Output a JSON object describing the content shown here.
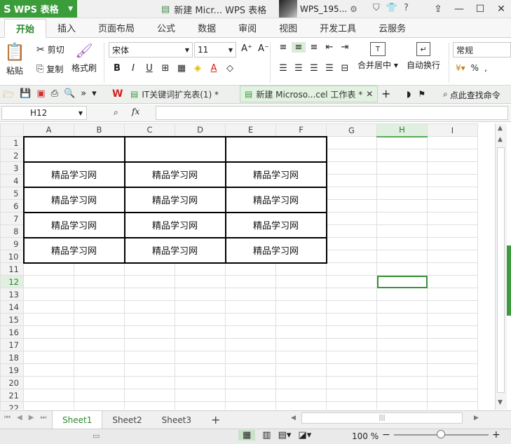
{
  "titlebar": {
    "app_name": "WPS 表格",
    "doc_title": "新建 Micr... WPS 表格",
    "user_name": "WPS_195..."
  },
  "menu": [
    "开始",
    "插入",
    "页面布局",
    "公式",
    "数据",
    "审阅",
    "视图",
    "开发工具",
    "云服务"
  ],
  "ribbon": {
    "paste": "粘贴",
    "cut": "剪切",
    "copy": "复制",
    "format_painter": "格式刷",
    "font_name": "宋体",
    "font_size": "11",
    "merge_center": "合并居中",
    "wrap_text": "自动换行",
    "number_format": "常规",
    "percent": "%"
  },
  "doc_tabs": [
    {
      "label": "IT关键词扩充表(1) *"
    },
    {
      "label": "新建 Microso...cel 工作表 *"
    }
  ],
  "find_command": "点此查找命令",
  "formula": {
    "cell_ref": "H12",
    "fx": "fx",
    "value": ""
  },
  "columns": [
    "A",
    "B",
    "C",
    "D",
    "E",
    "F",
    "G",
    "H",
    "I"
  ],
  "rows": [
    "1",
    "2",
    "3",
    "4",
    "5",
    "6",
    "7",
    "8",
    "9",
    "10",
    "11",
    "12",
    "13",
    "14",
    "15",
    "16",
    "17",
    "18",
    "19",
    "20",
    "21",
    "22"
  ],
  "cell_text": "精品学习网",
  "sheets": [
    "Sheet1",
    "Sheet2",
    "Sheet3"
  ],
  "zoom": "100 %"
}
